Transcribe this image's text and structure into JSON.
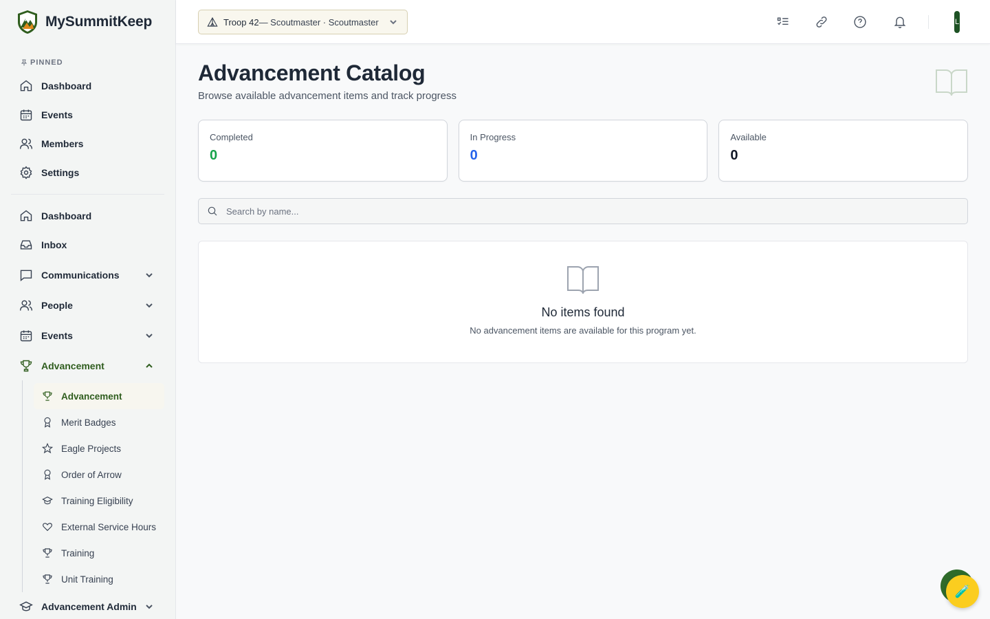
{
  "brand": {
    "name": "MySummitKeep"
  },
  "pinned": {
    "label": "PINNED",
    "items": [
      {
        "label": "Dashboard",
        "icon": "home-icon"
      },
      {
        "label": "Events",
        "icon": "calendar-icon"
      },
      {
        "label": "Members",
        "icon": "users-icon"
      },
      {
        "label": "Settings",
        "icon": "gear-icon"
      }
    ]
  },
  "nav": {
    "items": [
      {
        "label": "Dashboard",
        "icon": "home-icon"
      },
      {
        "label": "Inbox",
        "icon": "inbox-icon"
      },
      {
        "label": "Communications",
        "icon": "message-icon"
      },
      {
        "label": "People",
        "icon": "users-icon"
      },
      {
        "label": "Events",
        "icon": "calendar-icon"
      },
      {
        "label": "Advancement",
        "icon": "trophy-icon"
      }
    ],
    "advancement_sub": [
      {
        "label": "Advancement",
        "icon": "trophy-icon"
      },
      {
        "label": "Merit Badges",
        "icon": "award-icon"
      },
      {
        "label": "Eagle Projects",
        "icon": "star-icon"
      },
      {
        "label": "Order of Arrow",
        "icon": "award-icon"
      },
      {
        "label": "Training Eligibility",
        "icon": "graduation-cap-icon"
      },
      {
        "label": "External Service Hours",
        "icon": "heart-icon"
      },
      {
        "label": "Training",
        "icon": "trophy-icon"
      },
      {
        "label": "Unit Training",
        "icon": "trophy-icon"
      }
    ],
    "advancement_admin": {
      "label": "Advancement Admin",
      "icon": "graduation-cap-icon"
    }
  },
  "topbar": {
    "unit_name": "Troop 42",
    "unit_role": " — Scoutmaster · Scoutmaster",
    "avatar_initial": "L"
  },
  "page": {
    "title": "Advancement Catalog",
    "subtitle": "Browse available advancement items and track progress"
  },
  "stats": [
    {
      "label": "Completed",
      "value": "0",
      "color": "#16a34a"
    },
    {
      "label": "In Progress",
      "value": "0",
      "color": "#2563eb"
    },
    {
      "label": "Available",
      "value": "0",
      "color": "#111827"
    }
  ],
  "search": {
    "placeholder": "Search by name..."
  },
  "empty": {
    "title": "No items found",
    "description": "No advancement items are available for this program yet."
  },
  "colors": {
    "accent": "#2f5d1e",
    "fab": "#fbcd1f"
  }
}
